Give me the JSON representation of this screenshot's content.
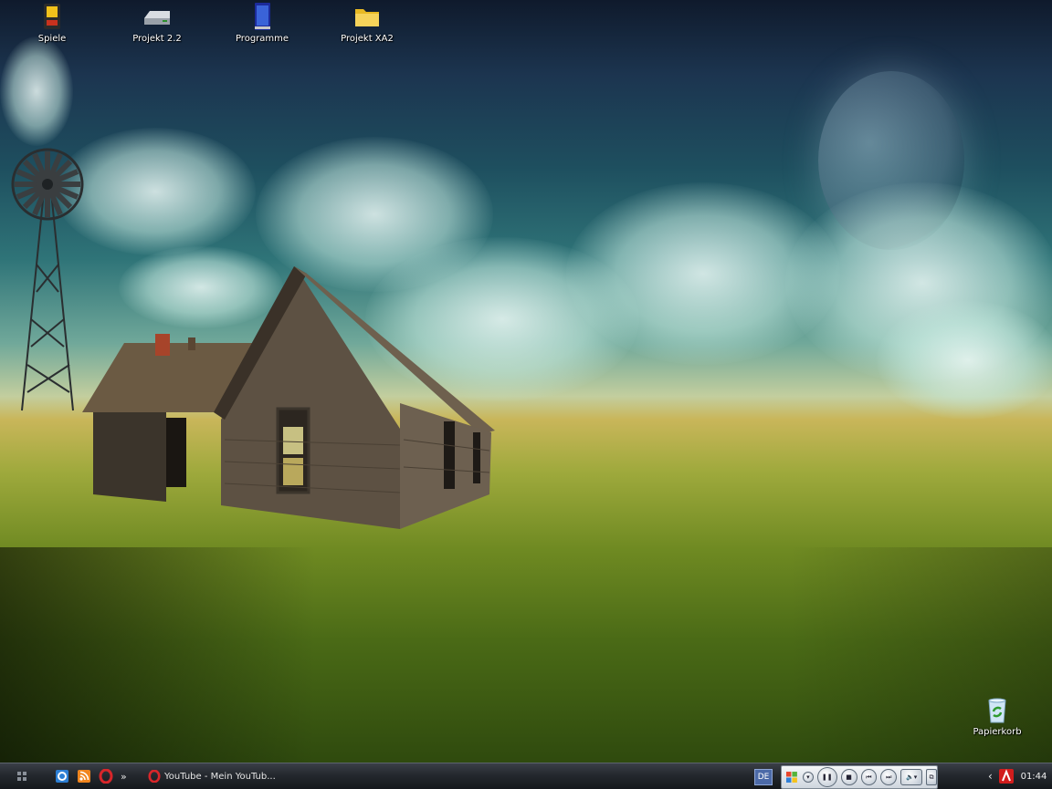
{
  "desktop": {
    "icons": [
      {
        "label": "Spiele",
        "icon": "game-cartridge-icon"
      },
      {
        "label": "Projekt 2.2",
        "icon": "drive-icon"
      },
      {
        "label": "Programme",
        "icon": "book-icon"
      },
      {
        "label": "Projekt XA2",
        "icon": "folder-icon"
      },
      {
        "label": "Papierkorb",
        "icon": "recycle-bin-icon"
      }
    ]
  },
  "taskbar": {
    "task_button_label": "YouTube - Mein YouTub...",
    "language": "DE",
    "clock": "01:44",
    "overflow_glyph": "»",
    "tray_expand_glyph": "‹"
  },
  "colors": {
    "taskbar": "#24282e",
    "lang_badge": "#4c6aa8"
  }
}
